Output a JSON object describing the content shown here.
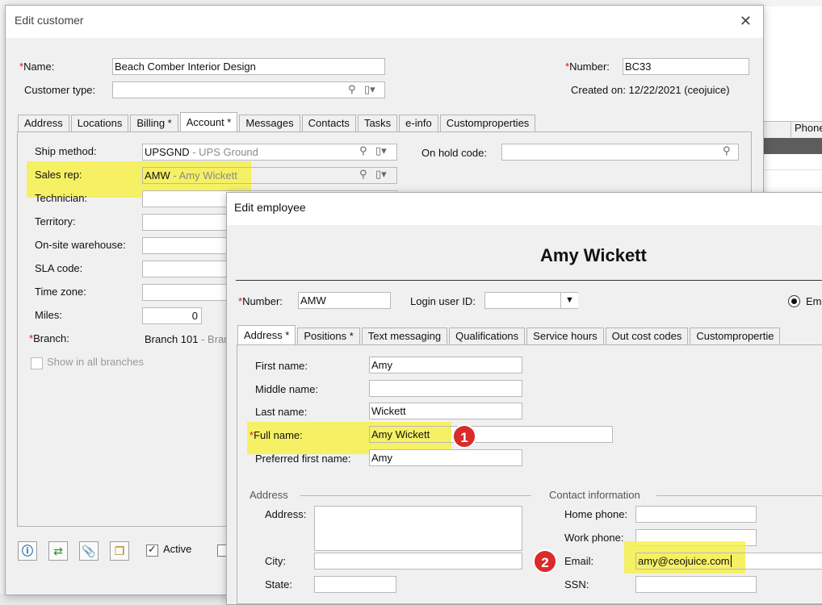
{
  "edit_customer": {
    "title": "Edit customer",
    "close": "✕",
    "name_label": "Name:",
    "name_value": "Beach Comber Interior Design",
    "customer_type_label": "Customer type:",
    "customer_type_value": "",
    "number_label": "Number:",
    "number_value": "BC33",
    "created_on": "Created on: 12/22/2021 (ceojuice)",
    "tabs": [
      "Address",
      "Locations",
      "Billing *",
      "Account *",
      "Messages",
      "Contacts",
      "Tasks",
      "e-info",
      "Customproperties"
    ],
    "ship_method_label": "Ship method:",
    "ship_method_code": "UPSGND",
    "ship_method_desc": " - UPS Ground",
    "on_hold_label": "On hold code:",
    "sales_rep_label": "Sales rep:",
    "sales_rep_code": "AMW",
    "sales_rep_desc": " - Amy Wickett",
    "technician_label": "Technician:",
    "territory_label": "Territory:",
    "onsite_label": "On-site warehouse:",
    "sla_label": "SLA code:",
    "timezone_label": "Time zone:",
    "miles_label": "Miles:",
    "miles_value": "0",
    "branch_label": "Branch:",
    "branch_code": "Branch 101",
    "branch_desc": " - Bran",
    "show_all_branches": "Show in all branches",
    "active_label": "Active"
  },
  "edit_employee": {
    "title": "Edit employee",
    "header_name": "Amy Wickett",
    "number_label": "Number:",
    "number_value": "AMW",
    "login_label": "Login user ID:",
    "radio_label": "Emp",
    "tabs": [
      "Address *",
      "Positions *",
      "Text messaging",
      "Qualifications",
      "Service hours",
      "Out cost codes",
      "Custompropertie"
    ],
    "first_name_label": "First name:",
    "first_name": "Amy",
    "middle_name_label": "Middle name:",
    "middle_name": "",
    "last_name_label": "Last name:",
    "last_name": "Wickett",
    "full_name_label": "Full name:",
    "full_name": "Amy Wickett",
    "preferred_label": "Preferred first name:",
    "preferred": "Amy",
    "address_group": "Address",
    "contact_group": "Contact information",
    "address_label": "Address:",
    "city_label": "City:",
    "state_label": "State:",
    "home_phone_label": "Home phone:",
    "work_phone_label": "Work phone:",
    "email_label": "Email:",
    "email_value": "amy@ceojuice.com",
    "ssn_label": "SSN:"
  },
  "badges": {
    "one": "1",
    "two": "2"
  },
  "background": {
    "phone_header": "Phone"
  },
  "colors": {
    "highlight": "#f7f03c",
    "badge": "#d92b2b",
    "required": "#dd1111"
  },
  "icons": [
    "search-icon",
    "dropdown-icon",
    "info-icon",
    "swap-icon",
    "attach-icon",
    "copy-icon",
    "close-icon"
  ]
}
